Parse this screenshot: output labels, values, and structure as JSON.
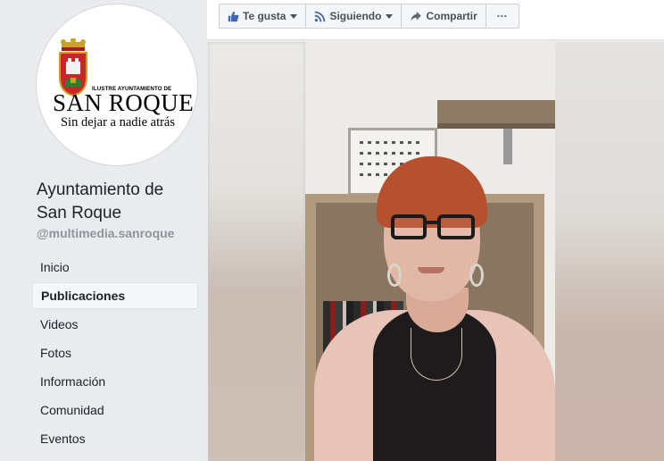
{
  "page": {
    "name": "Ayuntamiento de San Roque",
    "handle": "@multimedia.sanroque"
  },
  "logo": {
    "line_small": "ILUSTRE AYUNTAMIENTO DE",
    "line_main": "SAN ROQUE",
    "tagline": "Sin dejar a nadie atrás"
  },
  "actions": {
    "like_label": "Te gusta",
    "follow_label": "Siguiendo",
    "share_label": "Compartir",
    "more_label": "···"
  },
  "nav": {
    "items": [
      {
        "label": "Inicio",
        "active": false
      },
      {
        "label": "Publicaciones",
        "active": true
      },
      {
        "label": "Videos",
        "active": false
      },
      {
        "label": "Fotos",
        "active": false
      },
      {
        "label": "Información",
        "active": false
      },
      {
        "label": "Comunidad",
        "active": false
      },
      {
        "label": "Eventos",
        "active": false
      }
    ]
  },
  "colors": {
    "background": "#e9ebee",
    "text": "#1d2129",
    "muted": "#90949c",
    "accent": "#4267b2"
  }
}
